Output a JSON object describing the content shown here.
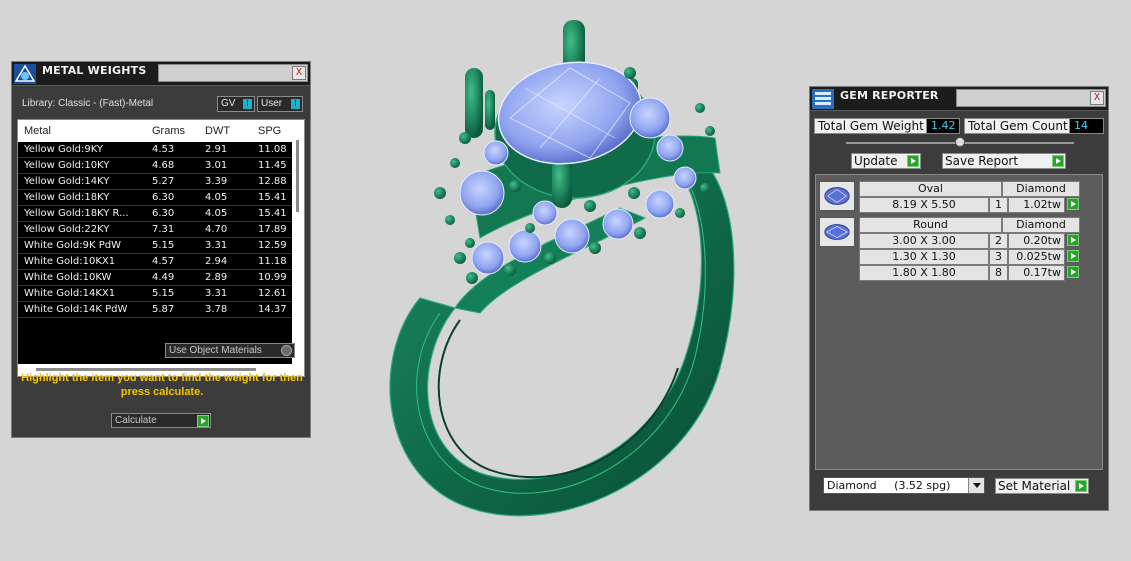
{
  "metal_panel": {
    "title": "METAL WEIGHTS",
    "library_label": "Library: Classic - (Fast)-Metal",
    "gv_label": "GV",
    "user_label": "User",
    "toggle_glyph": "I",
    "columns": [
      "Metal",
      "Grams",
      "DWT",
      "SPG"
    ],
    "rows": [
      [
        "Yellow Gold:9KY",
        "4.53",
        "2.91",
        "11.08"
      ],
      [
        "Yellow Gold:10KY",
        "4.68",
        "3.01",
        "11.45"
      ],
      [
        "Yellow Gold:14KY",
        "5.27",
        "3.39",
        "12.88"
      ],
      [
        "Yellow Gold:18KY",
        "6.30",
        "4.05",
        "15.41"
      ],
      [
        "Yellow Gold:18KY R...",
        "6.30",
        "4.05",
        "15.41"
      ],
      [
        "Yellow Gold:22KY",
        "7.31",
        "4.70",
        "17.89"
      ],
      [
        "White Gold:9K PdW",
        "5.15",
        "3.31",
        "12.59"
      ],
      [
        "White Gold:10KX1",
        "4.57",
        "2.94",
        "11.18"
      ],
      [
        "White Gold:10KW",
        "4.49",
        "2.89",
        "10.99"
      ],
      [
        "White Gold:14KX1",
        "5.15",
        "3.31",
        "12.61"
      ],
      [
        "White Gold:14K PdW",
        "5.87",
        "3.78",
        "14.37"
      ]
    ],
    "use_object_materials": "Use Object Materials",
    "hint": "Highlight the item you want to find the weight for then press calculate.",
    "calculate_label": "Calculate",
    "close_glyph": "X"
  },
  "gem_panel": {
    "title": "GEM REPORTER",
    "total_weight_label": "Total Gem Weight",
    "total_weight_value": "1.42",
    "total_count_label": "Total Gem Count",
    "total_count_value": "14",
    "update_label": "Update",
    "save_label": "Save Report",
    "groups": [
      {
        "shape": "Oval",
        "material": "Diamond",
        "rows": [
          [
            "8.19 X 5.50",
            "1",
            "1.02tw"
          ]
        ]
      },
      {
        "shape": "Round",
        "material": "Diamond",
        "rows": [
          [
            "3.00 X 3.00",
            "2",
            "0.20tw"
          ],
          [
            "1.30 X 1.30",
            "3",
            "0.025tw"
          ],
          [
            "1.80 X 1.80",
            "8",
            "0.17tw"
          ]
        ]
      }
    ],
    "material_select": "Diamond     (3.52 spg)",
    "set_material_label": "Set Material",
    "close_glyph": "X"
  },
  "colors": {
    "panel_bg": "#3c3c3c",
    "ring_green": "#0f6b4a",
    "gem_blue": "#8fa4f0",
    "hint_yellow": "#f5c400",
    "value_cyan": "#40d0f0"
  }
}
